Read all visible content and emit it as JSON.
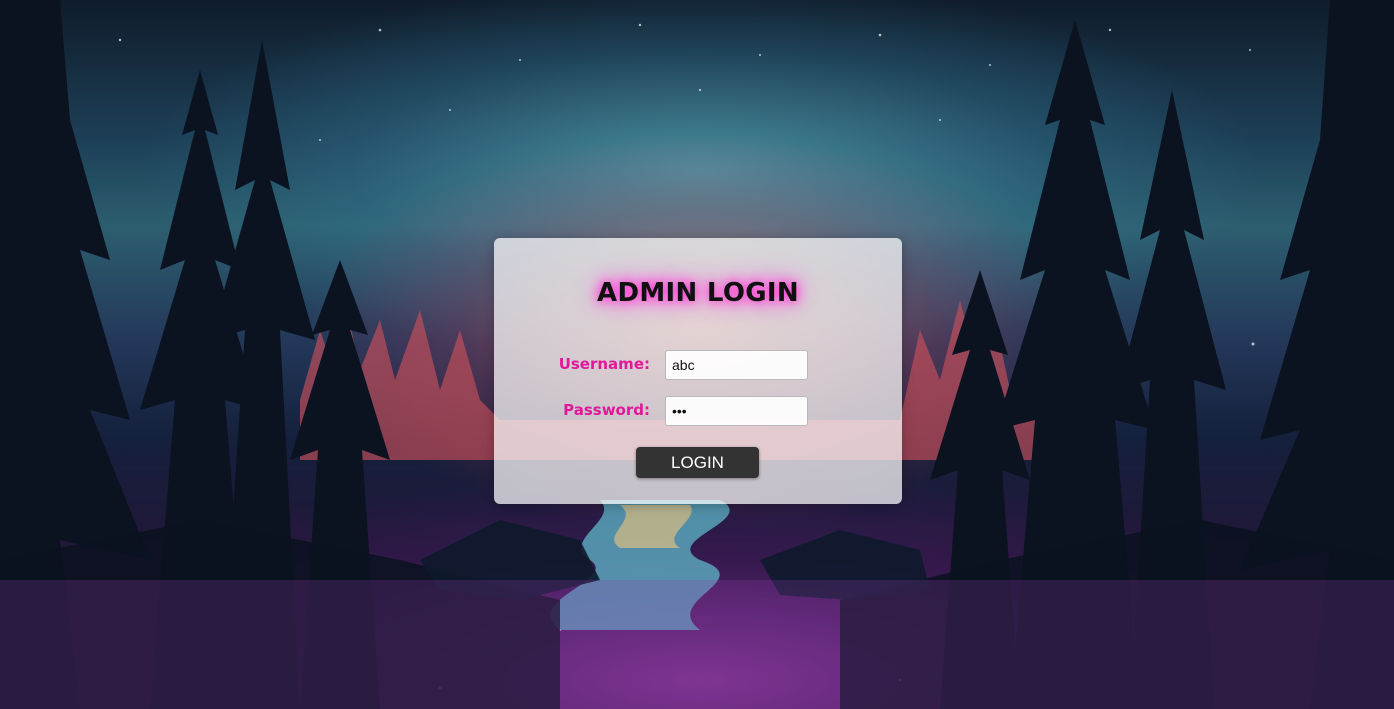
{
  "login": {
    "title": "ADMIN LOGIN",
    "username_label": "Username:",
    "username_value": "abc",
    "password_label": "Password:",
    "password_value": "abc",
    "button_label": "LOGIN"
  },
  "colors": {
    "label": "#e0189a",
    "title_glow": "#ff2fd0",
    "button_bg": "#333333",
    "button_text": "#ffffff"
  }
}
